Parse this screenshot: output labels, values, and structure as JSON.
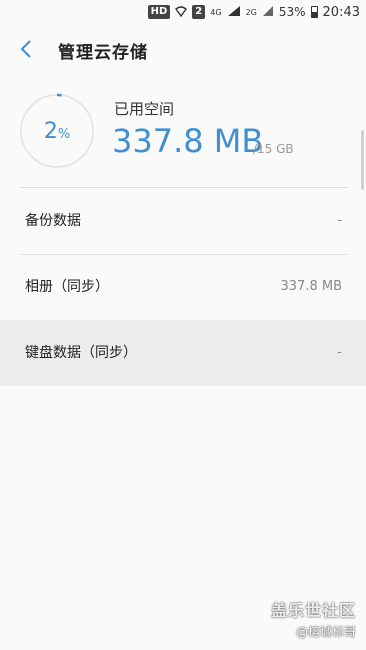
{
  "status_bar": {
    "hd_label": "HD",
    "sim_label": "2",
    "network_label": "4G",
    "network2_label": "2G",
    "battery_percent": "53%",
    "battery_level": 0.53,
    "time": "20:43"
  },
  "header": {
    "back_icon": "chevron-left-icon",
    "title": "管理云存储"
  },
  "storage": {
    "percent_number": "2",
    "percent_symbol": "%",
    "percent_value": 0.02,
    "used_label": "已用空间",
    "used_value": "337.8 MB",
    "total_value": "/15 GB",
    "accent_color": "#3f8fd2"
  },
  "items": [
    {
      "label": "备份数据",
      "value": "-"
    },
    {
      "label": "相册（同步）",
      "value": "337.8 MB"
    },
    {
      "label": "键盘数据（同步）",
      "value": "-"
    }
  ],
  "watermark": {
    "line1": "盖乐世社区",
    "line2": "@榕城标哥"
  }
}
